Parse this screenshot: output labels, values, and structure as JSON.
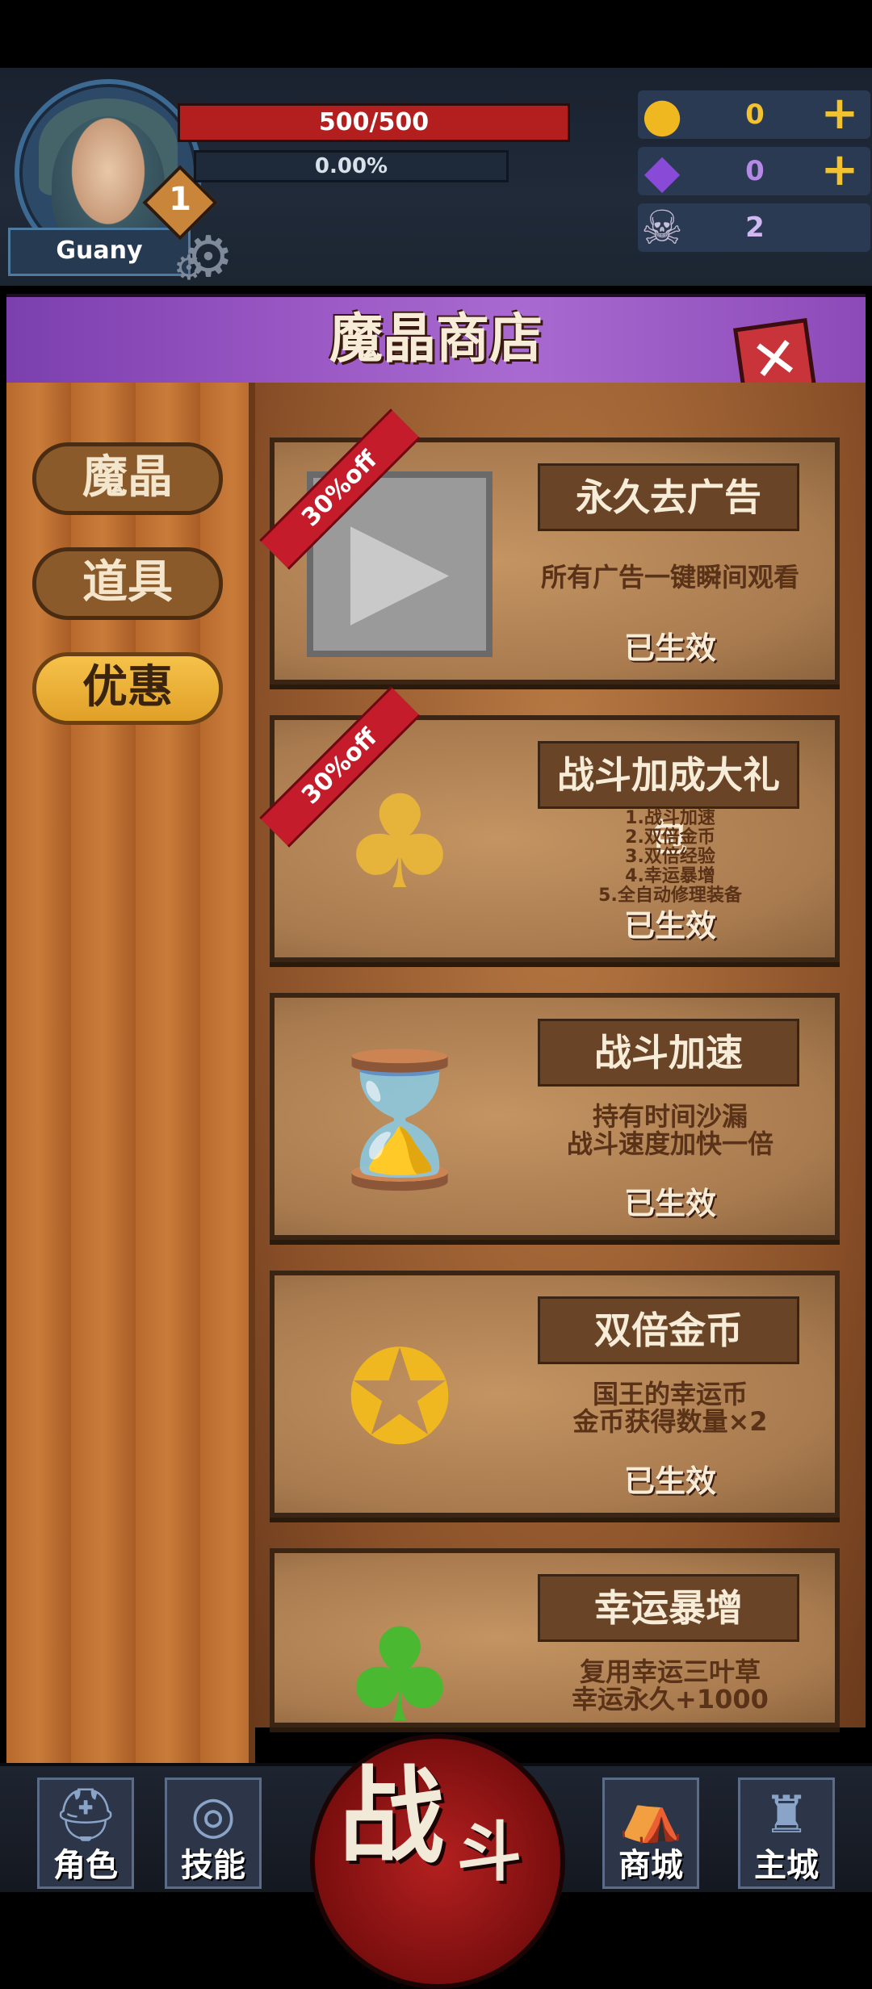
{
  "player": {
    "name": "Guany",
    "level": "1",
    "hp": "500/500",
    "xp": "0.00%"
  },
  "resources": {
    "gold": "0",
    "crystal": "0",
    "souls": "2",
    "plus": "+"
  },
  "shop": {
    "title": "魔晶商店",
    "close": "✕",
    "tabs": [
      "魔晶",
      "道具",
      "优惠"
    ]
  },
  "items": [
    {
      "title": "永久去广告",
      "desc": "所有广告一键瞬间观看",
      "status": "已生效",
      "ribbon": "30%off"
    },
    {
      "title": "战斗加成大礼包",
      "desc_lines": [
        "1.战斗加速",
        "2.双倍金币",
        "3.双倍经验",
        "4.幸运暴增",
        "5.全自动修理装备"
      ],
      "status": "已生效",
      "ribbon": "30%off"
    },
    {
      "title": "战斗加速",
      "desc_lines": [
        "持有时间沙漏",
        "战斗速度加快一倍"
      ],
      "status": "已生效"
    },
    {
      "title": "双倍金币",
      "desc_lines": [
        "国王的幸运币",
        "金币获得数量×2"
      ],
      "status": "已生效"
    },
    {
      "title": "幸运暴增",
      "desc_lines": [
        "复用幸运三叶草",
        "幸运永久+1000"
      ]
    }
  ],
  "nav": {
    "role": "角色",
    "skill": "技能",
    "battle_1": "战",
    "battle_2": "斗",
    "mall": "商城",
    "city": "主城"
  }
}
